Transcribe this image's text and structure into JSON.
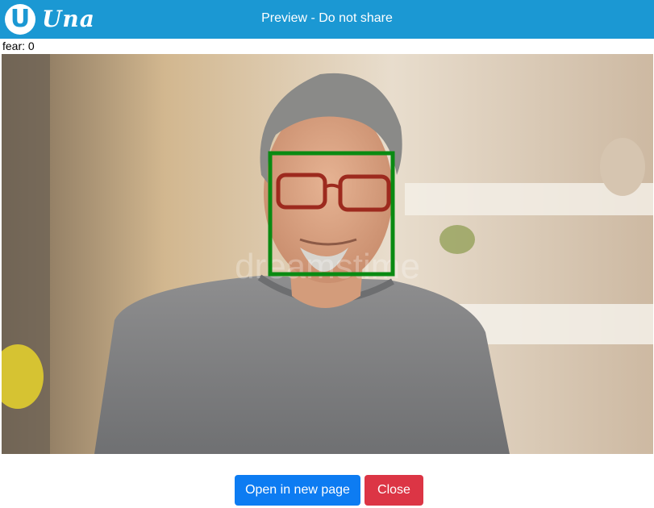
{
  "app": {
    "logo_letter": "U",
    "logo_text": "Una",
    "title": "Preview - Do not share"
  },
  "detection": {
    "emotion_label": "fear: 0"
  },
  "photo": {
    "watermark": "dreamstime",
    "face_box_color": "#0a8a12"
  },
  "actions": {
    "open_label": "Open in new page",
    "close_label": "Close"
  },
  "colors": {
    "header": "#1b98d3",
    "primary": "#0d7cf2",
    "danger": "#dc3545"
  }
}
